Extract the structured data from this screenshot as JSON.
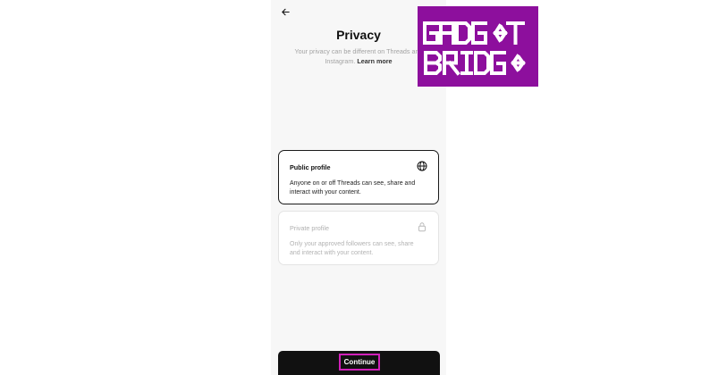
{
  "screen": {
    "title": "Privacy",
    "subtitle_text": "Your privacy can be different on Threads and Instagram.",
    "learn_more": "Learn more"
  },
  "options": [
    {
      "title": "Public profile",
      "description": "Anyone on or off Threads can see, share and interact with your content.",
      "icon": "globe-icon",
      "selected": true
    },
    {
      "title": "Private profile",
      "description": "Only your approved followers can see, share and interact with your content.",
      "icon": "lock-icon",
      "selected": false
    }
  ],
  "actions": {
    "continue_label": "Continue"
  },
  "watermark": {
    "line1": "GADGET",
    "line2": "BRIDGE"
  },
  "colors": {
    "highlight": "#d020b8",
    "watermark_bg": "#8d0f9d",
    "button_bg": "#111111"
  }
}
